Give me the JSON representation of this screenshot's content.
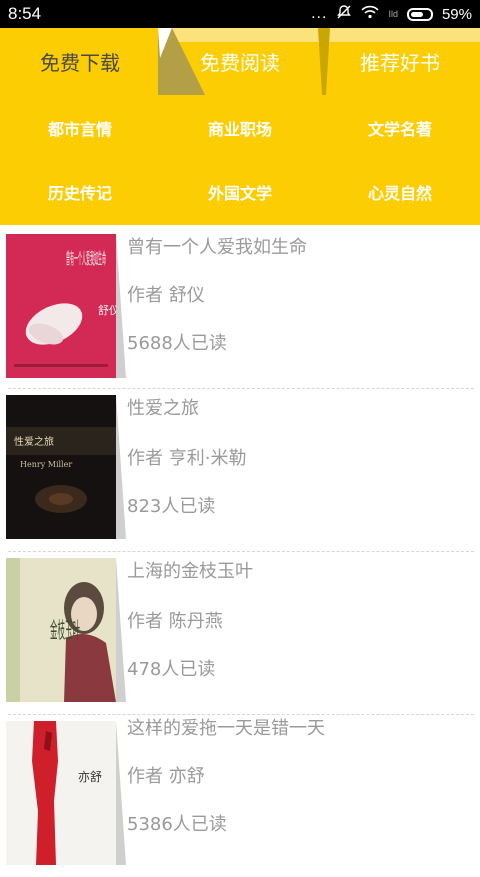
{
  "status": {
    "time": "8:54",
    "dots": "...",
    "signal": "Ild",
    "battery": "59%"
  },
  "tabs": [
    {
      "label": "免费下载"
    },
    {
      "label": "免费阅读"
    },
    {
      "label": "推荐好书"
    }
  ],
  "categories": [
    {
      "label": "都市言情"
    },
    {
      "label": "商业职场"
    },
    {
      "label": "文学名著"
    },
    {
      "label": "历史传记"
    },
    {
      "label": "外国文学"
    },
    {
      "label": "心灵自然"
    }
  ],
  "books": [
    {
      "title": "曾有一个人爱我如生命",
      "author": "作者  舒仪",
      "reads": "5688人已读",
      "cover_text": "曾有一个人爱我如生命",
      "cover_author": "舒仪"
    },
    {
      "title": "性爱之旅",
      "author": "作者  亨利·米勒",
      "reads": "823人已读",
      "cover_text": "性爱之旅",
      "cover_author": "Henry Miller"
    },
    {
      "title": "上海的金枝玉叶",
      "author": "作者  陈丹燕",
      "reads": "478人已读",
      "cover_text": "金枝玉叶",
      "cover_author": ""
    },
    {
      "title": "这样的爱拖一天是错一天",
      "author": "作者  亦舒",
      "reads": "5386人已读",
      "cover_text": "",
      "cover_author": "亦舒"
    }
  ],
  "colors": {
    "header": "#fccd02",
    "text_muted": "#9a9a9a"
  }
}
